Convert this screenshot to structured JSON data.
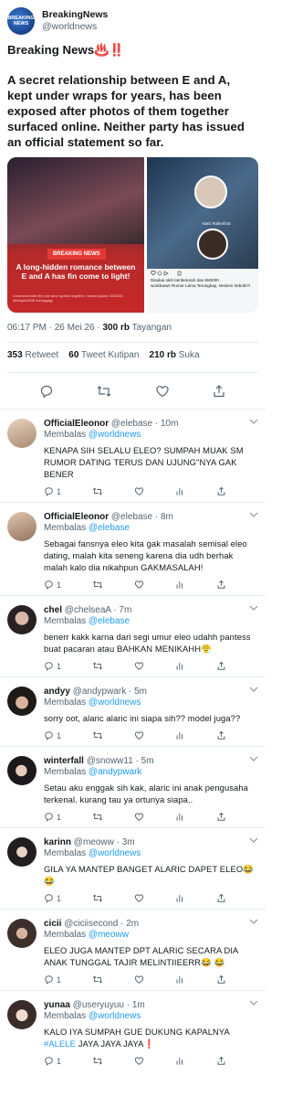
{
  "tweet": {
    "name": "BreakingNews",
    "handle": "@worldnews",
    "avatar_text": "BREAKING NEWS",
    "headline": "Breaking News♨️‼️",
    "body": "A secret relationship between E and A, kept under wraps for years, has been exposed after photos of them together surfaced online. Neither party has issued an official statement so far.",
    "media_left": {
      "pill": "BREAKING NEWS",
      "caption": "A long-hidden romance between E and A has fin come to light!",
      "small": "Uncovered after the pair were spotted together, ranked update 30/05/26 #thetgate2026 #unapgagy"
    },
    "media_right": {
      "label_name": "Alaric Rutherford",
      "caption_line1": "Disukai oleh lambeturah dan 650000",
      "caption_line2": "worldnews Rumor Lama Terungkap, Netizen hebohi?!"
    },
    "time": "06:17 PM · 26 Mei 26 ·",
    "views": "300 rb",
    "views_label": "Tayangan",
    "retweets": "353",
    "retweets_label": "Retweet",
    "quotes": "60",
    "quotes_label": "Tweet Kutipan",
    "likes": "210 rb",
    "likes_label": "Suka"
  },
  "replies": [
    {
      "name": "OfficialEleonor",
      "handle": "@elebase · 10m",
      "reply_to_label": "Membalas",
      "reply_to": "@worldnews",
      "text": "KENAPA SIH SELALU ELEO? SUMPAH MUAK SM RUMOR DATING TERUS DAN UJUNG\"NYA GAK BENER",
      "replies": "1",
      "avatar_color": "#c9a98a"
    },
    {
      "name": "OfficialEleonor",
      "handle": "@elebase · 8m",
      "reply_to_label": "Membalas",
      "reply_to": "@elebase",
      "text": "Sebagai fansnya eleo kita gak masalah semisal eleo dating, malah kita seneng karena dia udh berhak malah kalo dia nikahpun GAKMASALAH!",
      "replies": "1",
      "avatar_color": "#b89a80"
    },
    {
      "name": "chel",
      "handle": "@chelseaA · 7m",
      "reply_to_label": "Membalas",
      "reply_to": "@elebase",
      "text": "benerr kakk karna dari segi umur eleo udahh pantess buat pacaran atau BAHKAN MENIKAHH😤",
      "replies": "1",
      "avatar_color": "#3a2e2e"
    },
    {
      "name": "andyy",
      "handle": "@andypwark · 5m",
      "reply_to_label": "Membalas",
      "reply_to": "@worldnews",
      "text": "sorry oot, alaric alaric ini siapa sih?? model juga??",
      "replies": "1",
      "avatar_color": "#2b2420"
    },
    {
      "name": "winterfall",
      "handle": "@snoww11 · 5m",
      "reply_to_label": "Membalas",
      "reply_to": "@andypwark",
      "text": "Setau aku enggak sih kak, alaric ini anak pengusaha terkenal. kurang tau ya ortunya siapa..",
      "replies": "1",
      "avatar_color": "#1f1b1e"
    },
    {
      "name": "karinn",
      "handle": "@meoww · 3m",
      "reply_to_label": "Membalas",
      "reply_to": "@worldnews",
      "text": "GILA YA MANTEP BANGET ALARIC DAPET ELEO😂 😂",
      "replies": "1",
      "avatar_color": "#2a2326"
    },
    {
      "name": "cicii",
      "handle": "@ciciisecond · 2m",
      "reply_to_label": "Membalas",
      "reply_to": "@meoww",
      "text": "ELEO JUGA MANTEP DPT ALARIC SECARA DIA ANAK TUNGGAL TAJIR MELINTIIEERR😂 😂",
      "replies": "1",
      "avatar_color": "#4a3a35"
    },
    {
      "name": "yunaa",
      "handle": "@useryuyuu · 1m",
      "reply_to_label": "Membalas",
      "reply_to": "@worldnews",
      "text_before": "KALO IYA SUMPAH GUE DUKUNG KAPALNYA ",
      "hashtag": "#ALELE",
      "text_after": " JAYA JAYA JAYA❗",
      "replies": "1",
      "avatar_color": "#e0c8c0"
    }
  ]
}
